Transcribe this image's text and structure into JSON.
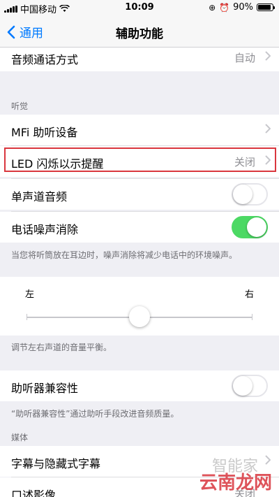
{
  "status": {
    "carrier": "中国移动",
    "time": "10:09",
    "battery": "90%",
    "battery_level": 0.9
  },
  "nav": {
    "back_label": "通用",
    "title": "辅助功能"
  },
  "rows": {
    "audio_call": {
      "label": "音频通话方式",
      "value": "自动"
    },
    "mfi": {
      "label": "MFi 助听设备"
    },
    "led": {
      "label": "LED 闪烁以示提醒",
      "value": "关闭"
    },
    "mono": {
      "label": "单声道音频",
      "on": false
    },
    "noise": {
      "label": "电话噪声消除",
      "on": true
    },
    "hac": {
      "label": "助听器兼容性",
      "on": false
    },
    "captions": {
      "label": "字幕与隐藏式字幕"
    },
    "audio_desc": {
      "label": "口述影像",
      "value": "关闭"
    }
  },
  "sections": {
    "hearing": "听觉",
    "media": "媒体"
  },
  "footers": {
    "noise": "当您将听筒放在耳边时，噪声消除将减少电话中的环境噪声。",
    "balance": "调节左右声道的音量平衡。",
    "hac": "“助听器兼容性”通过助听手段改进音频质量。"
  },
  "balance": {
    "left": "左",
    "right": "右",
    "value": 0.5
  },
  "watermark": {
    "text1": "智能家",
    "text2": "云南龙网"
  },
  "colors": {
    "accent": "#007aff",
    "toggle_on": "#4cd964",
    "highlight": "#d9363e"
  }
}
